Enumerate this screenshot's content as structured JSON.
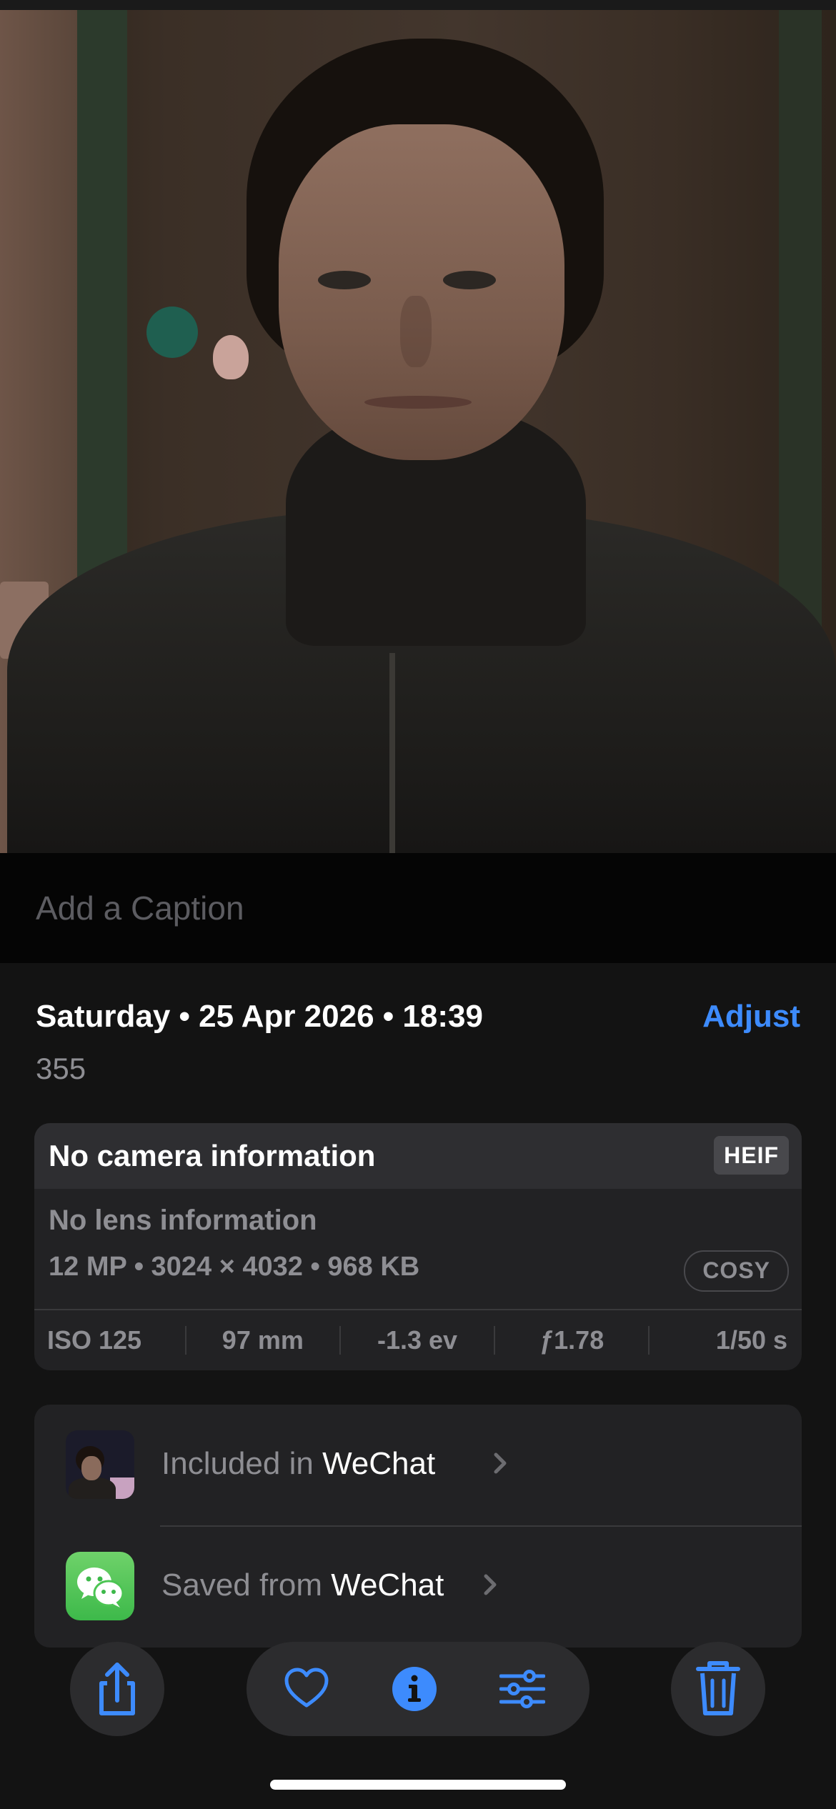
{
  "caption": {
    "placeholder": "Add a Caption"
  },
  "info": {
    "date_time": "Saturday • 25 Apr 2026 • 18:39",
    "adjust_label": "Adjust",
    "subtitle": "355"
  },
  "camera": {
    "title": "No camera information",
    "format_badge": "HEIF",
    "lens": "No lens information",
    "specs": "12 MP • 3024 × 4032 • 968 KB",
    "style_badge": "COSY",
    "exif": [
      "ISO 125",
      "97 mm",
      "-1.3 ev",
      "ƒ1.78",
      "1/50 s"
    ]
  },
  "albums": [
    {
      "prefix": "Included in",
      "name": "WeChat",
      "icon": "album-thumbnail"
    },
    {
      "prefix": "Saved from",
      "name": "WeChat",
      "icon": "wechat-app-icon"
    }
  ],
  "toolbar": {
    "icons": [
      "share-icon",
      "heart-icon",
      "info-icon",
      "adjust-sliders-icon",
      "trash-icon"
    ],
    "accent": "#3d8bfd"
  },
  "colors": {
    "accent": "#3d8bfd",
    "background": "#131313",
    "card": "#222224",
    "secondary_text": "#8e8e93"
  }
}
